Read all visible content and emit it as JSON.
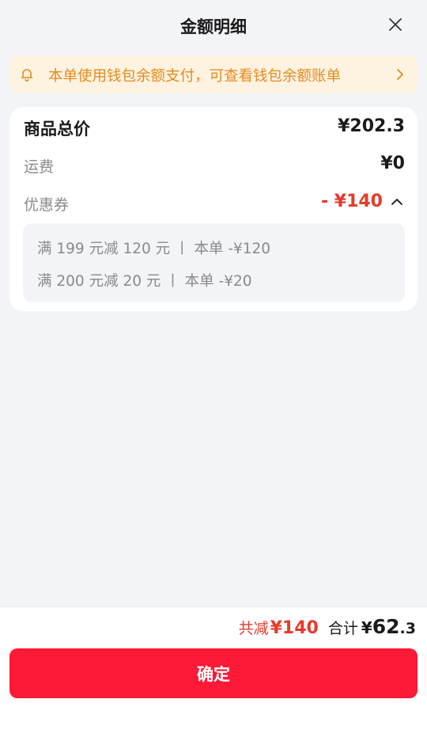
{
  "header": {
    "title": "金额明细",
    "close_icon": "close-icon"
  },
  "notice": {
    "icon": "bell-icon",
    "text": "本单使用钱包余额支付，可查看钱包余额账单",
    "chevron_icon": "chevron-right-icon",
    "color": "#e68a1e",
    "background": "#fdf3e0"
  },
  "breakdown": {
    "goods_label": "商品总价",
    "goods_value": "¥202.3",
    "shipping_label": "运费",
    "shipping_value": "¥0",
    "coupon_label": "优惠券",
    "coupon_value": "- ¥140",
    "coupon_toggle_icon": "chevron-up-icon",
    "coupons": [
      {
        "text": "满 199 元减 120 元  丨 本单 -¥120"
      },
      {
        "text": "满 200 元减 20 元  丨 本单 -¥20"
      }
    ]
  },
  "footer": {
    "reduce_label": "共减",
    "reduce_value": "¥140",
    "total_label": "合计",
    "total_yen": "¥",
    "total_int": "62",
    "total_dec": ".3",
    "confirm_label": "确定"
  },
  "colors": {
    "accent_red": "#e53a2b",
    "button_red": "#fd1a36",
    "page_bg": "#f3f4f8"
  }
}
